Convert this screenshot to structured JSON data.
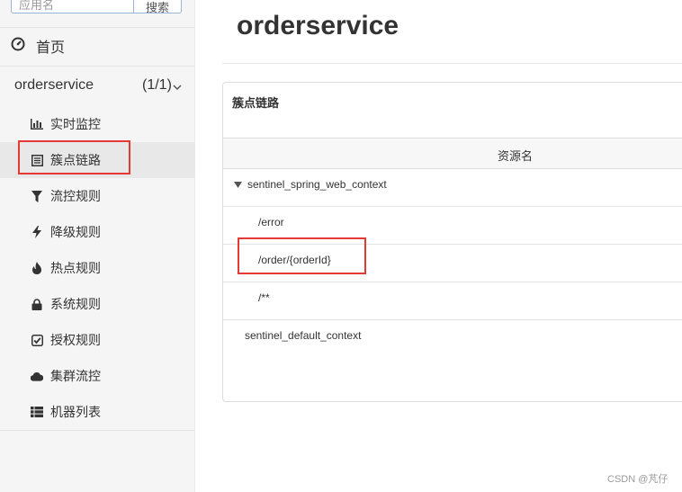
{
  "sidebar": {
    "search_placeholder": "应用名",
    "search_button": "搜索",
    "home_label": "首页",
    "app": {
      "name": "orderservice",
      "count": "(1/1)"
    },
    "items": [
      {
        "label": "实时监控",
        "icon": "bar-chart-icon"
      },
      {
        "label": "簇点链路",
        "icon": "list-icon",
        "active": true
      },
      {
        "label": "流控规则",
        "icon": "filter-icon"
      },
      {
        "label": "降级规则",
        "icon": "bolt-icon"
      },
      {
        "label": "热点规则",
        "icon": "fire-icon"
      },
      {
        "label": "系统规则",
        "icon": "lock-icon"
      },
      {
        "label": "授权规则",
        "icon": "check-square-icon"
      },
      {
        "label": "集群流控",
        "icon": "cloud-icon"
      },
      {
        "label": "机器列表",
        "icon": "th-list-icon"
      }
    ]
  },
  "main": {
    "title": "orderservice",
    "panel_title": "簇点链路",
    "column_header": "资源名",
    "rows": [
      {
        "name": "sentinel_spring_web_context",
        "level": 0,
        "expanded": true
      },
      {
        "name": "/error",
        "level": 1
      },
      {
        "name": "/order/{orderId}",
        "level": 1
      },
      {
        "name": "/**",
        "level": 1
      },
      {
        "name": "sentinel_default_context",
        "level": 0
      }
    ]
  },
  "watermark": "CSDN @芃仔",
  "colors": {
    "highlight": "#e53935",
    "sidebar_bg": "#f5f5f5",
    "active_bg": "#e8e8e8"
  }
}
